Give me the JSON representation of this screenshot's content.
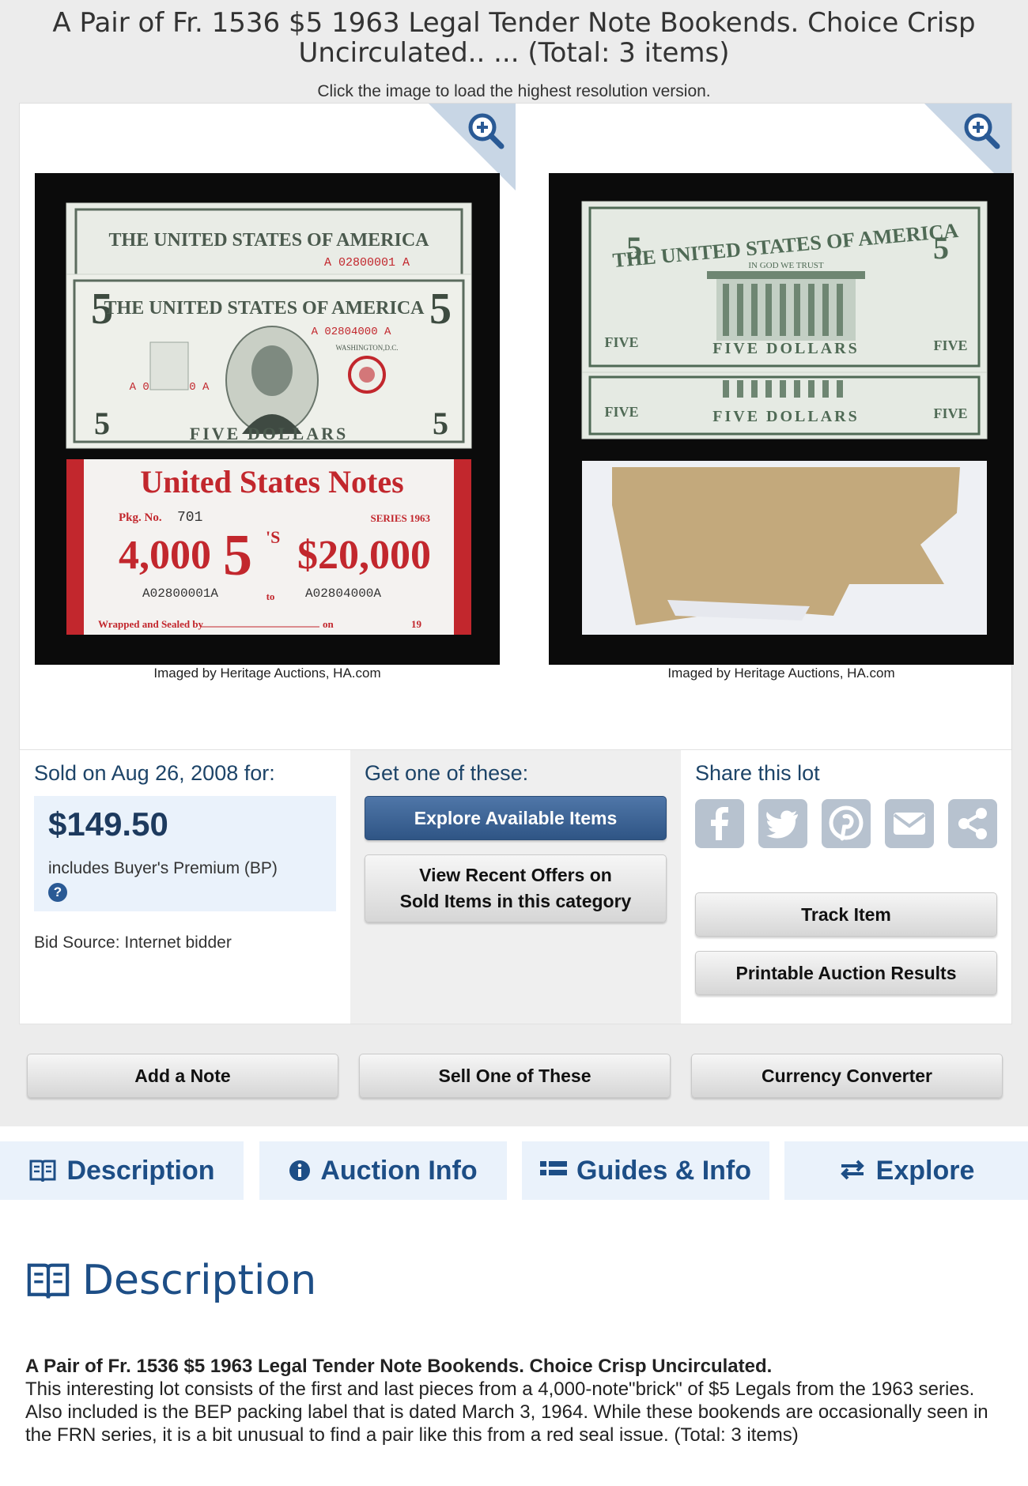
{
  "page": {
    "title": "A Pair of Fr. 1536 $5 1963 Legal Tender Note Bookends. Choice Crisp Uncirculated.. ... (Total: 3 items)",
    "title_line1": "A Pair of Fr. 1536 $5 1963 Legal Tender Note Bookends. Choice Crisp",
    "title_line2": "Uncirculated.. ... (Total: 3 items)",
    "hint": "Click the image to load the highest resolution version."
  },
  "gallery": {
    "images": [
      {
        "credit": "Imaged by Heritage Auctions, HA.com",
        "icon": "zoom-in-icon"
      },
      {
        "credit": "Imaged by Heritage Auctions, HA.com",
        "icon": "zoom-in-icon"
      }
    ]
  },
  "note_front": {
    "header": "THE UNITED STATES OF AMERICA",
    "serial_top": "A 02800001 A",
    "serial_mid": "A 02804000 A",
    "serial_left": "A 02804000 A",
    "bottom": "FIVE DOLLARS",
    "denom": "5",
    "place": "WASHINGTON,D.C."
  },
  "label": {
    "title": "United States Notes",
    "pkg_label": "Pkg. No.",
    "pkg_no": "701",
    "series": "SERIES 1963",
    "count": "4,000",
    "denom": "5",
    "denom_suffix": "'S",
    "amount": "$20,000",
    "from": "A02800001A",
    "to_word": "to",
    "to": "A02804000A",
    "wrapped": "Wrapped and Sealed by",
    "on": "on",
    "year": "19"
  },
  "note_back": {
    "header": "THE UNITED STATES OF AMERICA",
    "motto": "IN GOD WE TRUST",
    "five": "FIVE",
    "bottom": "FIVE DOLLARS",
    "denom": "5"
  },
  "sold": {
    "heading": "Sold on Aug 26, 2008 for:",
    "price": "$149.50",
    "bp": "includes Buyer's Premium (BP)",
    "help": "?",
    "bid_source": "Bid Source: Internet bidder"
  },
  "get": {
    "heading": "Get one of these:",
    "explore": "Explore Available Items",
    "recent_line1": "View Recent Offers on",
    "recent_line2": "Sold Items in this category"
  },
  "share": {
    "heading": "Share this lot",
    "icons": [
      "facebook-icon",
      "twitter-icon",
      "pinterest-icon",
      "email-icon",
      "share-icon"
    ],
    "track": "Track Item",
    "printable": "Printable Auction Results"
  },
  "actions": {
    "add_note": "Add a Note",
    "sell": "Sell One of These",
    "currency": "Currency Converter"
  },
  "tabs": {
    "description": "Description",
    "auction_info": "Auction Info",
    "guides": "Guides & Info",
    "explore": "Explore"
  },
  "description": {
    "heading": "Description",
    "title": "A Pair of Fr. 1536 $5 1963 Legal Tender Note Bookends. Choice Crisp Uncirculated.",
    "body": "This interesting lot consists of the first and last pieces from a 4,000-note\"brick\" of $5 Legals from the 1963 series. Also included is the BEP packing label that is dated March 3, 1964. While these bookends are occasionally seen in the FRN series, it is a bit unusual to find a pair like this from a red seal issue. (Total: 3 items)"
  },
  "colors": {
    "accent": "#1d4e86",
    "tab_bg": "#eaf2fb",
    "button_blue": "#3a6194",
    "seal_red": "#c2272d"
  }
}
